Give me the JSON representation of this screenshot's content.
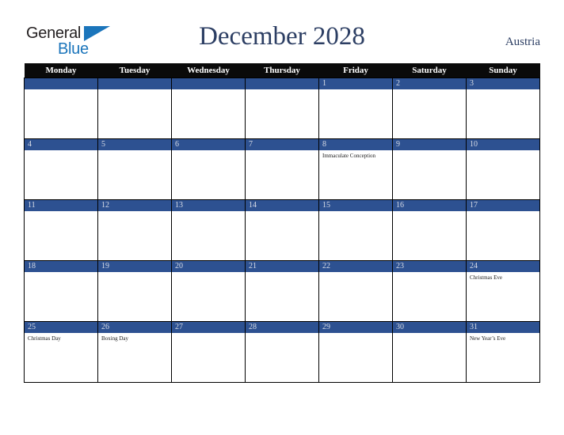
{
  "brand": {
    "word_one": "General",
    "word_two": "Blue",
    "triangle_icon": "triangle-icon",
    "color_dark": "#231f20",
    "color_blue": "#1b75bb"
  },
  "header": {
    "title": "December 2028",
    "country": "Austria",
    "title_color": "#2c3e63"
  },
  "calendar": {
    "month": "December",
    "year": "2028",
    "accent_blue": "#2d5191",
    "header_bg": "#0a0a0a",
    "weekday_headers": [
      "Monday",
      "Tuesday",
      "Wednesday",
      "Thursday",
      "Friday",
      "Saturday",
      "Sunday"
    ],
    "weeks": [
      [
        {
          "day": "",
          "events": []
        },
        {
          "day": "",
          "events": []
        },
        {
          "day": "",
          "events": []
        },
        {
          "day": "",
          "events": []
        },
        {
          "day": "1",
          "events": []
        },
        {
          "day": "2",
          "events": []
        },
        {
          "day": "3",
          "events": []
        }
      ],
      [
        {
          "day": "4",
          "events": []
        },
        {
          "day": "5",
          "events": []
        },
        {
          "day": "6",
          "events": []
        },
        {
          "day": "7",
          "events": []
        },
        {
          "day": "8",
          "events": [
            "Immaculate Conception"
          ]
        },
        {
          "day": "9",
          "events": []
        },
        {
          "day": "10",
          "events": []
        }
      ],
      [
        {
          "day": "11",
          "events": []
        },
        {
          "day": "12",
          "events": []
        },
        {
          "day": "13",
          "events": []
        },
        {
          "day": "14",
          "events": []
        },
        {
          "day": "15",
          "events": []
        },
        {
          "day": "16",
          "events": []
        },
        {
          "day": "17",
          "events": []
        }
      ],
      [
        {
          "day": "18",
          "events": []
        },
        {
          "day": "19",
          "events": []
        },
        {
          "day": "20",
          "events": []
        },
        {
          "day": "21",
          "events": []
        },
        {
          "day": "22",
          "events": []
        },
        {
          "day": "23",
          "events": []
        },
        {
          "day": "24",
          "events": [
            "Christmas Eve"
          ]
        }
      ],
      [
        {
          "day": "25",
          "events": [
            "Christmas Day"
          ]
        },
        {
          "day": "26",
          "events": [
            "Boxing Day"
          ]
        },
        {
          "day": "27",
          "events": []
        },
        {
          "day": "28",
          "events": []
        },
        {
          "day": "29",
          "events": []
        },
        {
          "day": "30",
          "events": []
        },
        {
          "day": "31",
          "events": [
            "New Year’s Eve"
          ]
        }
      ]
    ]
  }
}
